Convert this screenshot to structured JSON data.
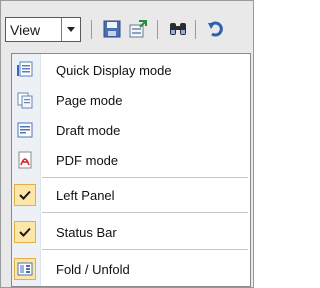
{
  "toolbar": {
    "view_label": "View",
    "icons": [
      "save-icon",
      "export-icon",
      "find-icon",
      "undo-icon"
    ]
  },
  "menu": {
    "items": [
      {
        "label": "Quick Display mode",
        "icon": "quick-display-icon"
      },
      {
        "label": "Page mode",
        "icon": "page-mode-icon"
      },
      {
        "label": "Draft mode",
        "icon": "draft-mode-icon"
      },
      {
        "label": "PDF mode",
        "icon": "pdf-icon"
      },
      {
        "label": "Left Panel",
        "icon": "checkmark-icon",
        "checked": true
      },
      {
        "label": "Status Bar",
        "icon": "checkmark-icon",
        "checked": true
      },
      {
        "label": "Fold / Unfold",
        "icon": "fold-unfold-icon"
      }
    ]
  },
  "colors": {
    "check_bg": "#fde7a8",
    "check_border": "#e0b14a",
    "gutter": "#edf1f6"
  }
}
